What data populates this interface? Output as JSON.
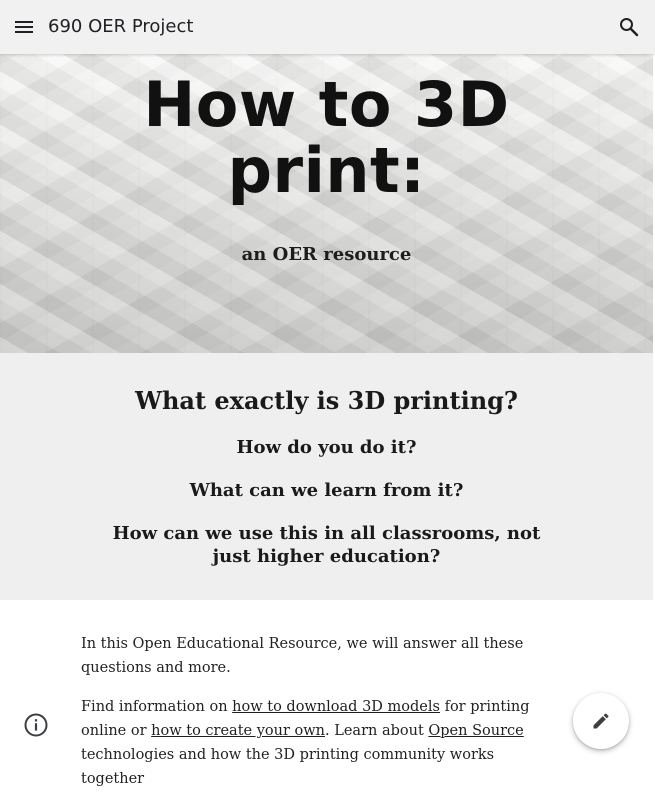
{
  "header": {
    "site_title": "690 OER Project",
    "menu_icon": "menu-icon",
    "search_icon": "search-icon"
  },
  "hero": {
    "title_line1": "How to 3D",
    "title_line2": "print:",
    "subtitle": "an OER resource"
  },
  "questions": {
    "main": "What exactly is 3D printing?",
    "q1": "How do you do it?",
    "q2": "What can we learn from it?",
    "q3": "How can we use this in all classrooms, not just higher education?"
  },
  "content": {
    "para1": "In this Open Educational Resource, we will answer all these questions and more.",
    "para2_part1": "Find information on ",
    "link_download": "how to download 3D models",
    "para2_part2": " for printing online or ",
    "link_create": "how to create your own",
    "para2_part3": ". Learn about ",
    "link_open_source": "Open Source",
    "para2_part4": " technologies and how the 3D printing community works together"
  },
  "controls": {
    "info_icon": "info-icon",
    "edit_icon": "edit-icon"
  },
  "colors": {
    "appbar": "#f1f1f1",
    "questions_band": "#efefef",
    "text": "#222222"
  }
}
